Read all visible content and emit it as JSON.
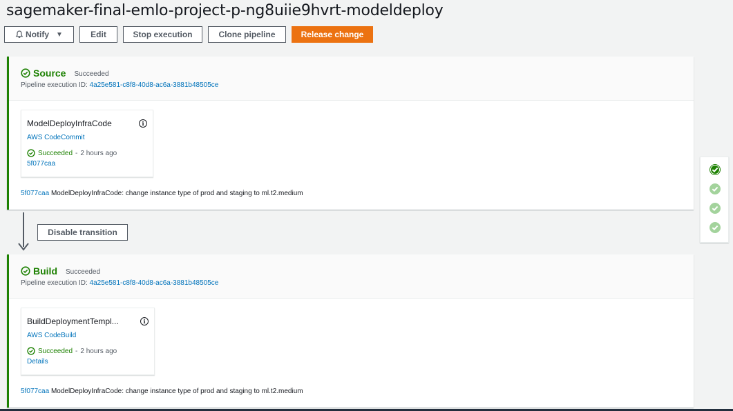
{
  "page": {
    "title": "sagemaker-final-emlo-project-p-ng8uiie9hvrt-modeldeploy"
  },
  "toolbar": {
    "notify": "Notify",
    "edit": "Edit",
    "stop": "Stop execution",
    "clone": "Clone pipeline",
    "release": "Release change"
  },
  "colors": {
    "success": "#1d8102",
    "link": "#0073bb",
    "primary": "#ec7211"
  },
  "stages": [
    {
      "name": "Source",
      "status": "Succeeded",
      "exec_label": "Pipeline execution ID:",
      "exec_id": "4a25e581-c8f8-40d8-ac6a-3881b48505ce",
      "action": {
        "name": "ModelDeployInfraCode",
        "provider": "AWS CodeCommit",
        "status": "Succeeded",
        "time": "2 hours ago",
        "link": "5f077caa"
      },
      "commit_id": "5f077caa",
      "commit_msg": "ModelDeployInfraCode: change instance type of prod and staging to ml.t2.medium"
    },
    {
      "name": "Build",
      "status": "Succeeded",
      "exec_label": "Pipeline execution ID:",
      "exec_id": "4a25e581-c8f8-40d8-ac6a-3881b48505ce",
      "action": {
        "name": "BuildDeploymentTempl...",
        "provider": "AWS CodeBuild",
        "status": "Succeeded",
        "time": "2 hours ago",
        "link": "Details"
      },
      "commit_id": "5f077caa",
      "commit_msg": "ModelDeployInfraCode: change instance type of prod and staging to ml.t2.medium"
    }
  ],
  "transition": {
    "label": "Disable transition"
  },
  "icons": {
    "status": "check-circle-icon",
    "info": "info-icon",
    "notify": "bell-icon",
    "dropdown": "caret-down-icon"
  }
}
